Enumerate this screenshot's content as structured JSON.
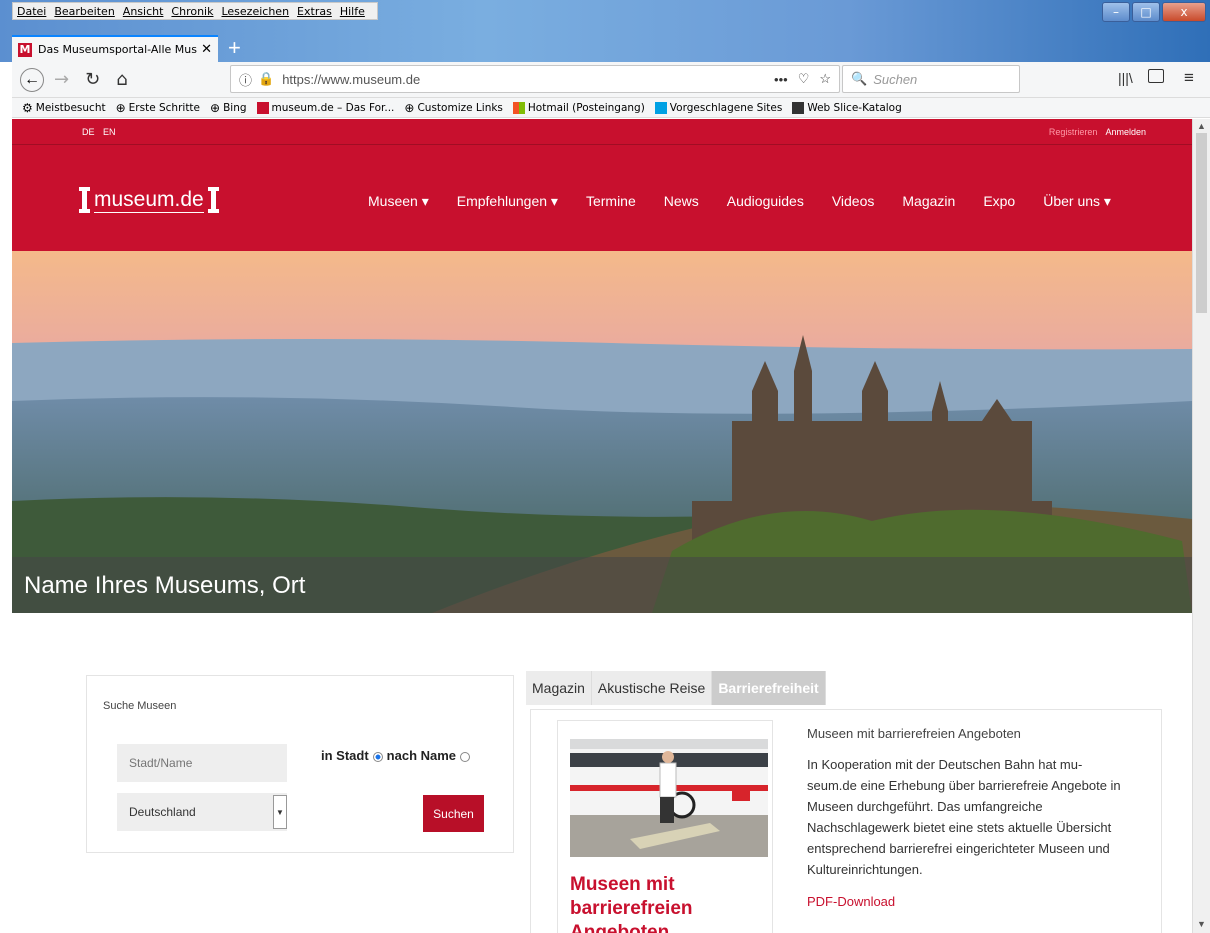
{
  "browser": {
    "menu": [
      "Datei",
      "Bearbeiten",
      "Ansicht",
      "Chronik",
      "Lesezeichen",
      "Extras",
      "Hilfe"
    ],
    "tab_title": "Das Museumsportal-Alle Muse",
    "url": "https://www.museum.de",
    "search_placeholder": "Suchen",
    "bookmarks": [
      "Meistbesucht",
      "Erste Schritte",
      "Bing",
      "museum.de – Das For...",
      "Customize Links",
      "Hotmail (Posteingang)",
      "Vorgeschlagene Sites",
      "Web Slice-Katalog"
    ],
    "window_buttons": {
      "minimize": "–",
      "maximize": "□",
      "close": "x"
    }
  },
  "site": {
    "lang": [
      "DE",
      "EN"
    ],
    "register": "Registrieren",
    "login": "Anmelden",
    "logo": "museum.de",
    "nav": [
      "Museen ▾",
      "Empfehlungen ▾",
      "Termine",
      "News",
      "Audioguides",
      "Videos",
      "Magazin",
      "Expo",
      "Über uns ▾"
    ]
  },
  "hero": {
    "caption": "Name Ihres Museums, Ort"
  },
  "search": {
    "title": "Suche Museen",
    "placeholder": "Stadt/Name",
    "country": "Deutschland",
    "radio_city": "in Stadt",
    "radio_name": "nach Name",
    "submit": "Suchen"
  },
  "tabs": [
    "Magazin",
    "Akustische Reise",
    "Barrierefreiheit"
  ],
  "panel": {
    "card_title": "Museen mit barrierefreien Angeboten",
    "title": "Museen mit barrierefreien Angeboten",
    "body": "In Kooperation mit der Deutschen Bahn hat mu­seum.de eine Erhebung über barrierefreie Ange­bote in Museen durchgeführt. Das umfangreiche Nachschlagewerk bietet eine stets aktuelle Über­sicht entsprechend barrierefrei eingerichteter Museen und Kultureinrichtungen.",
    "download": "PDF-Download"
  },
  "colors": {
    "brand": "#c8102e",
    "accent": "#0a84ff"
  }
}
